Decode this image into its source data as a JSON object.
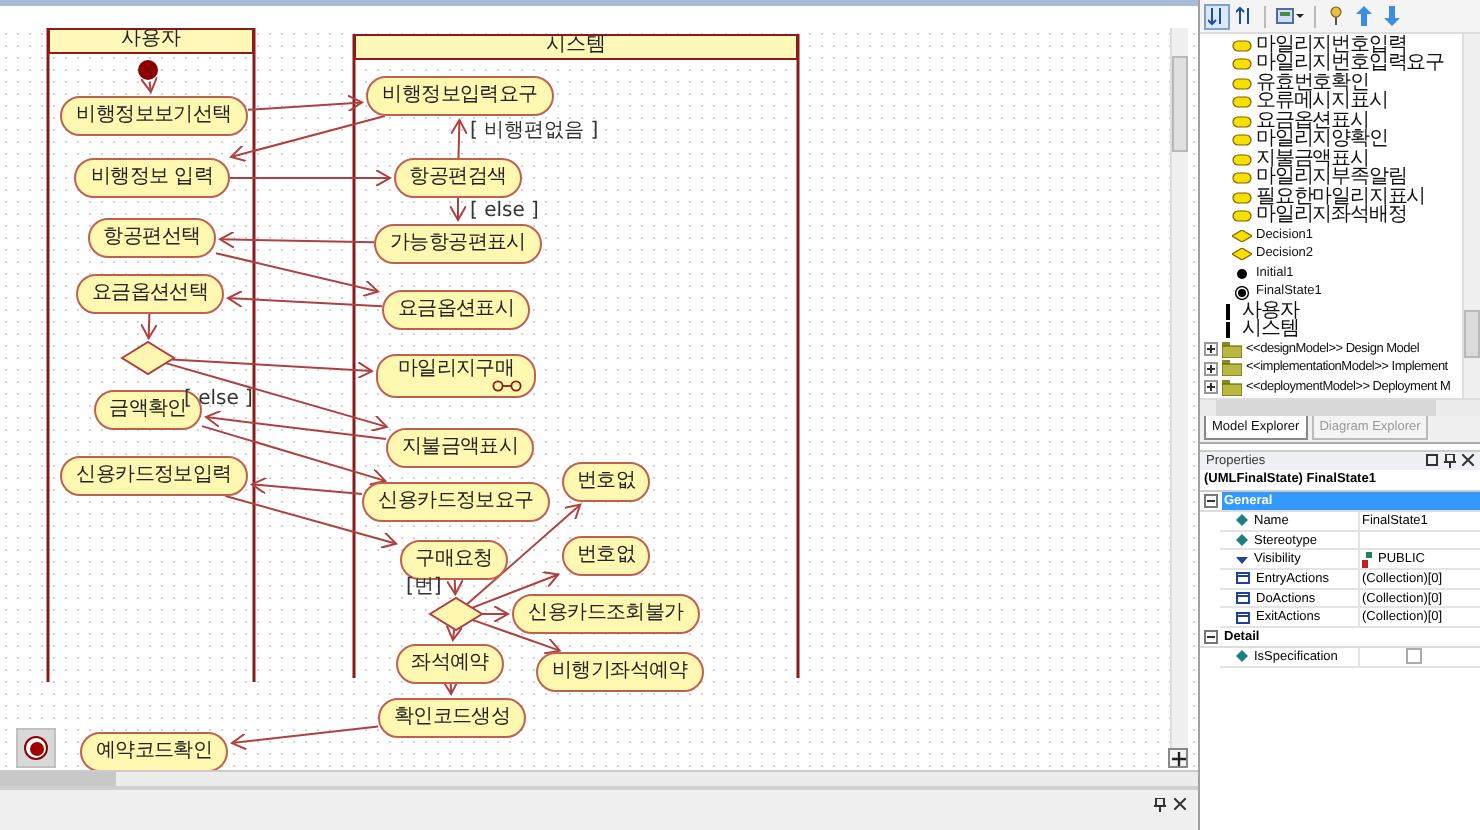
{
  "canvas": {
    "partitions": [
      {
        "name": "사용자"
      },
      {
        "name": "시스템"
      }
    ],
    "nodes": [
      {
        "kind": "initial",
        "selected": false
      },
      {
        "kind": "action",
        "label": "비행정보보기선택",
        "selected": false
      },
      {
        "kind": "action",
        "label": "비행정보 입력",
        "selected": false
      },
      {
        "kind": "action",
        "label": "항공편선택",
        "selected": false
      },
      {
        "kind": "action",
        "label": "요금옵션선택",
        "selected": false
      },
      {
        "kind": "decision",
        "selected": false
      },
      {
        "kind": "action",
        "label": "금액확인",
        "selected": false
      },
      {
        "kind": "action",
        "label": "신용카드정보입력",
        "selected": false
      },
      {
        "kind": "action",
        "label": "예약코드확인",
        "selected": false
      },
      {
        "kind": "final",
        "selected": true
      },
      {
        "kind": "action",
        "label": "비행정보입력요구",
        "selected": false
      },
      {
        "kind": "action",
        "label": "항공편검색",
        "selected": false
      },
      {
        "kind": "action",
        "label": "가능항공편표시",
        "selected": false
      },
      {
        "kind": "action",
        "label": "요금옵션표시",
        "selected": false
      },
      {
        "kind": "subactivity",
        "label": "마일리지구매",
        "selected": false
      },
      {
        "kind": "action",
        "label": "지불금액표시",
        "selected": false
      },
      {
        "kind": "action",
        "label": "신용카드정보요구",
        "selected": false
      },
      {
        "kind": "action",
        "label": "구매요청",
        "selected": false
      },
      {
        "kind": "decision",
        "selected": false
      },
      {
        "kind": "action",
        "label": "좌석예약",
        "selected": false
      },
      {
        "kind": "action",
        "label": "확인코드생성",
        "selected": false
      },
      {
        "kind": "action",
        "label": "번호없",
        "selected": false
      },
      {
        "kind": "action",
        "label": "번호없",
        "selected": false
      },
      {
        "kind": "action",
        "label": "신용카드조회불가",
        "selected": false
      },
      {
        "kind": "action",
        "label": "비행기좌석예약",
        "selected": false
      }
    ],
    "guards": [
      {
        "text": "[ 비행편없음 ]"
      },
      {
        "text": "[ else ]"
      },
      {
        "text": "[ else ]"
      },
      {
        "text": "[번]"
      }
    ]
  },
  "explorer": {
    "tree": [
      {
        "kind": "group",
        "children": [
          {
            "kind": "group",
            "children": [
              {
                "kind": "activity",
                "label": "마일리지번호입력"
              },
              {
                "kind": "activity",
                "label": "마일리지번호입력요구"
              },
              {
                "kind": "activity",
                "label": "유효번호확인"
              },
              {
                "kind": "activity",
                "label": "오류메시지표시"
              },
              {
                "kind": "activity",
                "label": "요금옵션표시"
              },
              {
                "kind": "activity",
                "label": "마일리지양확인"
              },
              {
                "kind": "activity",
                "label": "지불금액표시"
              },
              {
                "kind": "activity",
                "label": "마일리지부족알림"
              },
              {
                "kind": "activity",
                "label": "필요한마일리지표시"
              },
              {
                "kind": "activity",
                "label": "마일리지좌석배정"
              },
              {
                "kind": "decision",
                "label": "Decision1"
              },
              {
                "kind": "decision",
                "label": "Decision2"
              },
              {
                "kind": "initial",
                "label": "Initial1"
              },
              {
                "kind": "final",
                "label": "FinalState1"
              }
            ]
          },
          {
            "kind": "partition",
            "label": "사용자"
          },
          {
            "kind": "partition",
            "label": "시스템"
          }
        ]
      },
      {
        "kind": "model",
        "label": "<<designModel>> Design Model",
        "expanded": false
      },
      {
        "kind": "model",
        "label": "<<implementationModel>> Implement",
        "expanded": false
      },
      {
        "kind": "model",
        "label": "<<deploymentModel>> Deployment M",
        "expanded": false
      }
    ],
    "tabs": [
      {
        "label": "Model Explorer",
        "selected": true
      },
      {
        "label": "Diagram Explorer",
        "selected": false
      }
    ]
  },
  "properties": {
    "title": "Properties",
    "subject": "(UMLFinalState) FinalState1",
    "sections": [
      {
        "name": "General",
        "selected": true,
        "expanded": true,
        "rows": [
          {
            "kind": "attribute",
            "name": "Name",
            "value": "FinalState1"
          },
          {
            "kind": "attribute",
            "name": "Stereotype"
          },
          {
            "kind": "enum",
            "name": "Visibility",
            "value": "PUBLIC"
          },
          {
            "kind": "collection",
            "name": "EntryActions",
            "value": "(Collection)[0]"
          },
          {
            "kind": "collection",
            "name": "DoActions",
            "value": "(Collection)[0]"
          },
          {
            "kind": "collection",
            "name": "ExitActions",
            "value": "(Collection)[0]"
          }
        ]
      },
      {
        "name": "Detail",
        "selected": false,
        "expanded": true,
        "rows": [
          {
            "kind": "checkbox",
            "name": "IsSpecification",
            "checked": false
          }
        ]
      }
    ]
  }
}
